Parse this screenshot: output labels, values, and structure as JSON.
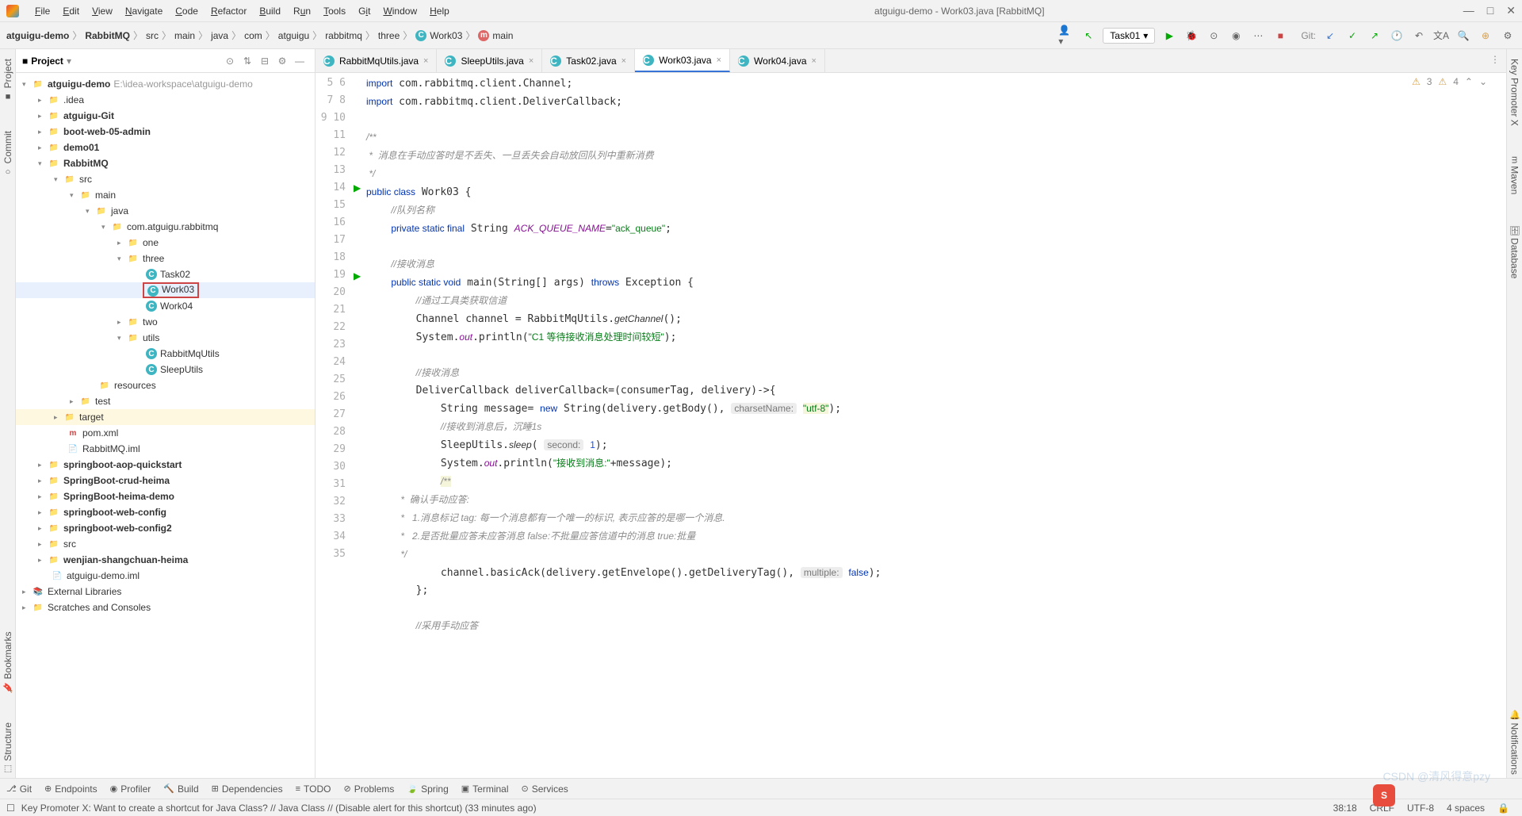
{
  "menu": {
    "items": [
      "File",
      "Edit",
      "View",
      "Navigate",
      "Code",
      "Refactor",
      "Build",
      "Run",
      "Tools",
      "Git",
      "Window",
      "Help"
    ],
    "title": "atguigu-demo - Work03.java [RabbitMQ]"
  },
  "breadcrumb": {
    "project": "atguigu-demo",
    "module": "RabbitMQ",
    "parts": [
      "src",
      "main",
      "java",
      "com",
      "atguigu",
      "rabbitmq",
      "three"
    ],
    "class": "Work03",
    "method": "main"
  },
  "toolbar": {
    "run_config": "Task01",
    "git_label": "Git:"
  },
  "project": {
    "header": "Project",
    "root": {
      "name": "atguigu-demo",
      "path": "E:\\idea-workspace\\atguigu-demo"
    },
    "nodes": [
      ".idea",
      "atguigu-Git",
      "boot-web-05-admin",
      "demo01",
      "RabbitMQ",
      "src",
      "main",
      "java",
      "com.atguigu.rabbitmq",
      "one",
      "three",
      "Task02",
      "Work03",
      "Work04",
      "two",
      "utils",
      "RabbitMqUtils",
      "SleepUtils",
      "resources",
      "test",
      "target",
      "pom.xml",
      "RabbitMQ.iml",
      "springboot-aop-quickstart",
      "SpringBoot-crud-heima",
      "SpringBoot-heima-demo",
      "springboot-web-config",
      "springboot-web-config2",
      "src",
      "wenjian-shangchuan-heima",
      "atguigu-demo.iml",
      "External Libraries",
      "Scratches and Consoles"
    ]
  },
  "tabs": [
    {
      "name": "RabbitMqUtils.java",
      "active": false
    },
    {
      "name": "SleepUtils.java",
      "active": false
    },
    {
      "name": "Task02.java",
      "active": false
    },
    {
      "name": "Work03.java",
      "active": true
    },
    {
      "name": "Work04.java",
      "active": false
    }
  ],
  "editor": {
    "lines_start": 5,
    "lines_end": 35,
    "warn1": "3",
    "warn2": "4",
    "code": {
      "l5": "import com.rabbitmq.client.Channel;",
      "l6": "import com.rabbitmq.client.DeliverCallback;",
      "l8": "/**",
      "l9": " *  消息在手动应答时是不丢失、一旦丢失会自动放回队列中重新消费",
      "l10": " */",
      "l11": "public class Work03 {",
      "l12": "    //队列名称",
      "l13a": "    private static final String ",
      "l13b": "ACK_QUEUE_NAME",
      "l13c": "=\"ack_queue\";",
      "l15": "    //接收消息",
      "l16": "    public static void main(String[] args) throws Exception {",
      "l17": "        //通过工具类获取信道",
      "l18": "        Channel channel = RabbitMqUtils.getChannel();",
      "l19a": "        System.",
      "l19b": "out",
      "l19c": ".println(\"C1 等待接收消息处理时间较短\");",
      "l21": "        //接收消息",
      "l22": "        DeliverCallback deliverCallback=(consumerTag, delivery)->{",
      "l23a": "            String message= new String(delivery.getBody(), ",
      "l23h": "charsetName:",
      "l23b": " \"utf-8\");",
      "l24": "            //接收到消息后，沉睡1s",
      "l25a": "            SleepUtils.sleep( ",
      "l25h": "second:",
      "l25b": " 1);",
      "l26a": "            System.",
      "l26b": "out",
      "l26c": ".println(\"接收到消息:\"+message);",
      "l27": "            /**",
      "l28": "             *  确认手动应答:",
      "l29": "             *   1.消息标记 tag: 每一个消息都有一个唯一的标识, 表示应答的是哪一个消息.",
      "l30": "             *   2.是否批量应答未应答消息 false:不批量应答信道中的消息 true:批量",
      "l31": "             */",
      "l32a": "            channel.basicAck(delivery.getEnvelope().getDeliveryTag(), ",
      "l32h": "multiple:",
      "l32b": " false);",
      "l33": "        };",
      "l35": "        //采用手动应答"
    }
  },
  "bottom_tools": [
    "Git",
    "Endpoints",
    "Profiler",
    "Build",
    "Dependencies",
    "TODO",
    "Problems",
    "Spring",
    "Terminal",
    "Services"
  ],
  "status": {
    "msg": "Key Promoter X: Want to create a shortcut for Java Class? // Java Class // (Disable alert for this shortcut) (33 minutes ago)",
    "pos": "38:18",
    "crlf": "CRLF",
    "enc": "UTF-8",
    "indent": "4 spaces"
  },
  "left_tabs": [
    "Project",
    "Commit",
    "Bookmarks",
    "Structure"
  ],
  "right_tabs": [
    "Key Promoter X",
    "Maven",
    "Database",
    "Notifications"
  ],
  "watermark": "CSDN @清风得意pzy"
}
